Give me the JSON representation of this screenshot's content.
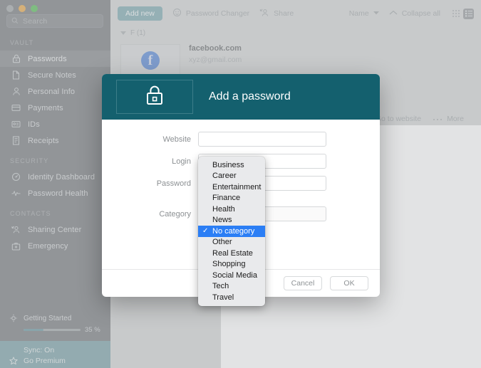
{
  "window": {
    "traffic_lights": [
      "close",
      "minimize",
      "zoom"
    ]
  },
  "sidebar": {
    "search": {
      "placeholder": "Search",
      "value": "",
      "icon": "search-icon"
    },
    "sections": [
      {
        "title": "VAULT",
        "items": [
          {
            "label": "Passwords",
            "icon": "lock-icon",
            "active": true
          },
          {
            "label": "Secure Notes",
            "icon": "note-icon",
            "active": false
          },
          {
            "label": "Personal Info",
            "icon": "person-icon",
            "active": false
          },
          {
            "label": "Payments",
            "icon": "card-icon",
            "active": false
          },
          {
            "label": "IDs",
            "icon": "id-card-icon",
            "active": false
          },
          {
            "label": "Receipts",
            "icon": "receipt-icon",
            "active": false
          }
        ]
      },
      {
        "title": "SECURITY",
        "items": [
          {
            "label": "Identity Dashboard",
            "icon": "dashboard-icon",
            "active": false
          },
          {
            "label": "Password Health",
            "icon": "pulse-icon",
            "active": false
          }
        ]
      },
      {
        "title": "CONTACTS",
        "items": [
          {
            "label": "Sharing Center",
            "icon": "share-person-icon",
            "active": false
          },
          {
            "label": "Emergency",
            "icon": "emergency-kit-icon",
            "active": false
          }
        ]
      }
    ],
    "getting_started": {
      "label": "Getting Started",
      "percent_label": "35 %",
      "percent_value": 35,
      "icon": "bulb-icon"
    },
    "status": {
      "sync_label": "Sync: On",
      "premium_label": "Go Premium",
      "premium_icon": "star-icon",
      "bar_color": "#6f9aa0"
    }
  },
  "toolbar": {
    "add_new_label": "Add new",
    "password_changer_label": "Password Changer",
    "password_changer_icon": "password-changer-icon",
    "share_label": "Share",
    "share_icon": "share-icon",
    "sort_label": "Name",
    "sort_caret_icon": "chevron-down-icon",
    "collapse_label": "Collapse all",
    "collapse_icon": "chevron-up-icon",
    "grid_view_icon": "grid-view-icon",
    "list_view_icon": "list-view-icon",
    "active_view": "list"
  },
  "list": {
    "group_header": "F (1)",
    "group_caret_icon": "triangle-down-icon",
    "entries": [
      {
        "name": "facebook.com",
        "login": "xyz@gmail.com",
        "favicon": "facebook-icon",
        "favicon_letter": "f"
      }
    ],
    "actions": {
      "go_to_website_label": "Go to website",
      "go_to_website_icon": "external-link-icon",
      "more_label": "More",
      "more_icon": "ellipsis-icon"
    }
  },
  "modal": {
    "title": "Add a password",
    "header_icon": "lock-icon",
    "header_color": "#14606e",
    "fields": [
      {
        "label": "Website",
        "value": "",
        "type": "text"
      },
      {
        "label": "Login",
        "value": "",
        "type": "text"
      },
      {
        "label": "Password",
        "value": "",
        "type": "password"
      }
    ],
    "category_field": {
      "label": "Category",
      "selected": "No category"
    },
    "cancel_label": "Cancel",
    "ok_label": "OK"
  },
  "dropdown": {
    "selected": "No category",
    "check_glyph": "✓",
    "highlight_color": "#2b7ef5",
    "options": [
      "Business",
      "Career",
      "Entertainment",
      "Finance",
      "Health",
      "News",
      "No category",
      "Other",
      "Real Estate",
      "Shopping",
      "Social Media",
      "Tech",
      "Travel"
    ]
  }
}
